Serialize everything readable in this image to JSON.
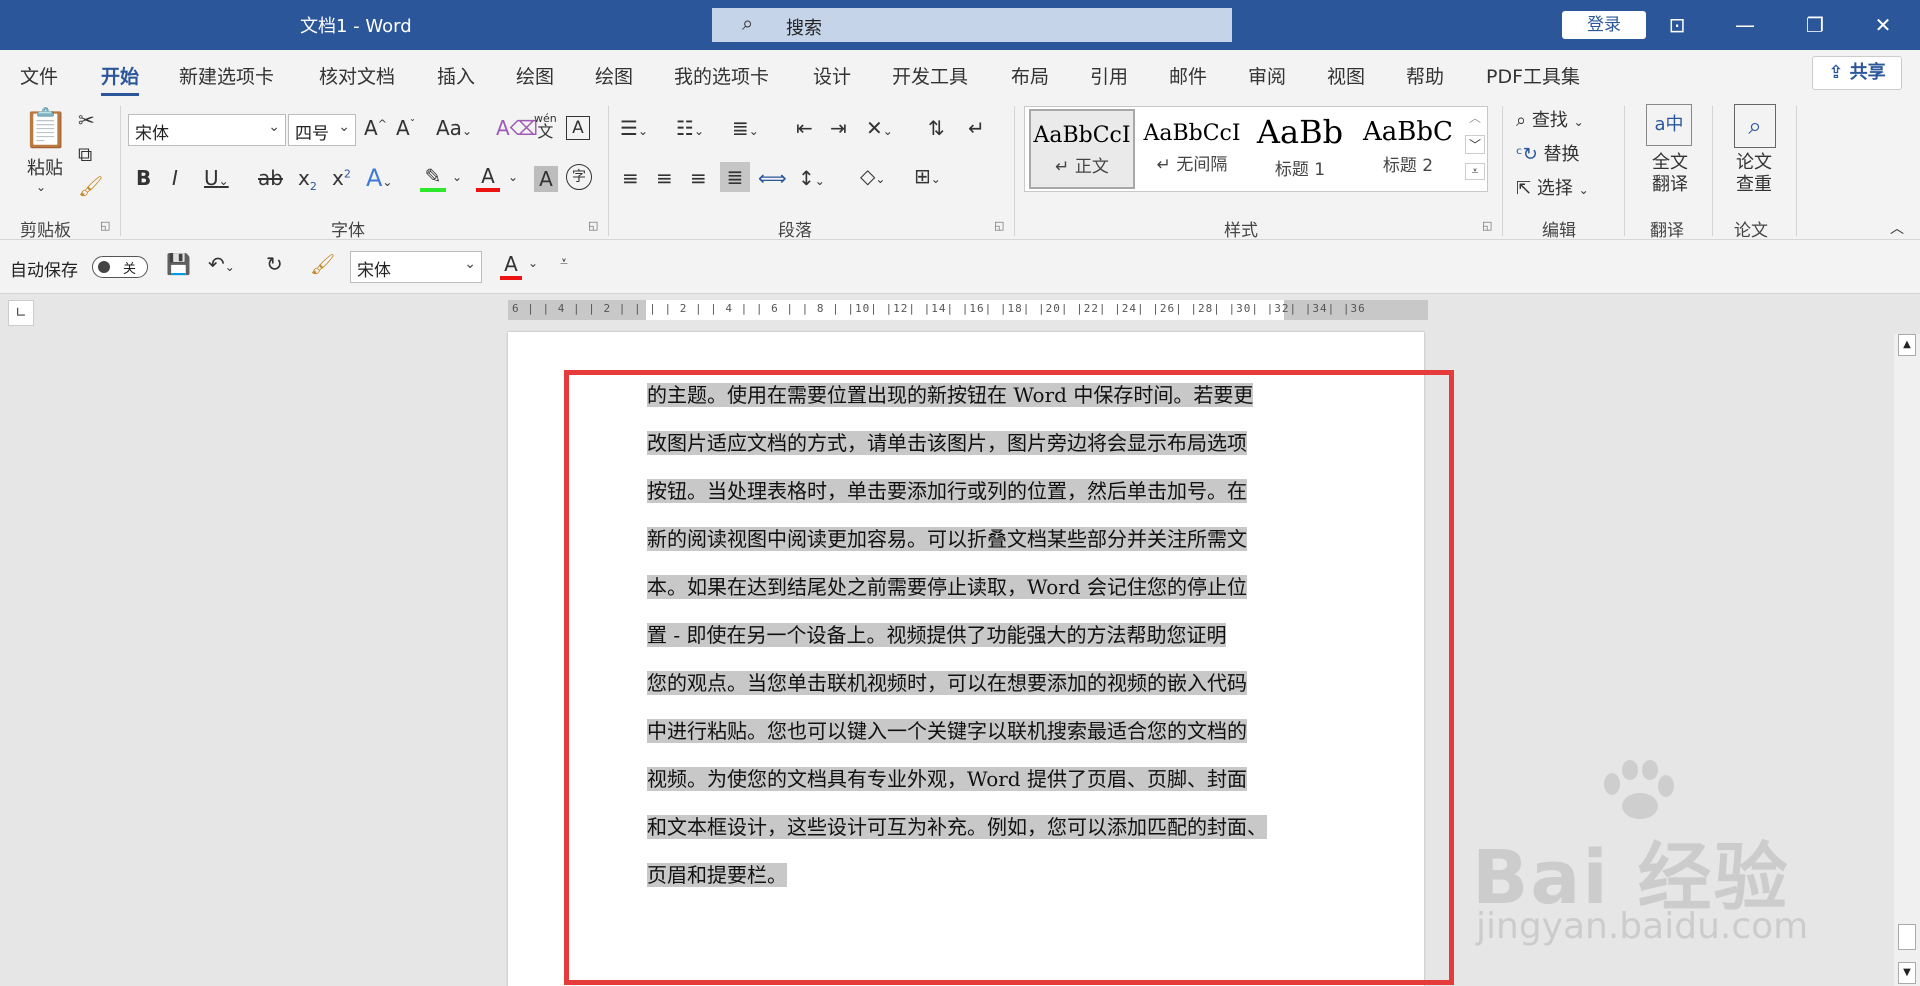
{
  "titlebar": {
    "title": "文档1  -  Word",
    "search_placeholder": "搜索",
    "login": "登录"
  },
  "tabs": [
    "文件",
    "开始",
    "新建选项卡",
    "核对文档",
    "插入",
    "绘图",
    "绘图",
    "我的选项卡",
    "设计",
    "开发工具",
    "布局",
    "引用",
    "邮件",
    "审阅",
    "视图",
    "帮助",
    "PDF工具集"
  ],
  "share": "共享",
  "ribbon": {
    "clipboard": {
      "paste": "粘贴",
      "label": "剪贴板"
    },
    "font": {
      "name": "宋体",
      "size": "四号",
      "label": "字体",
      "case": "Aa",
      "phonetic_top": "wén",
      "phonetic_bottom": "文"
    },
    "paragraph": {
      "label": "段落"
    },
    "styles": {
      "label": "样式",
      "items": [
        {
          "sample": "AaBbCcI",
          "name": "↵ 正文"
        },
        {
          "sample": "AaBbCcI",
          "name": "↵ 无间隔"
        },
        {
          "sample": "AaBb",
          "name": "标题 1"
        },
        {
          "sample": "AaBbC",
          "name": "标题 2"
        }
      ]
    },
    "editing": {
      "find": "查找",
      "replace": "替换",
      "select": "选择",
      "label": "编辑"
    },
    "translate": {
      "full": "全文",
      "translate": "翻译",
      "label": "翻译"
    },
    "paper": {
      "check1": "论文",
      "check2": "查重",
      "label": "论文"
    }
  },
  "qat": {
    "autosave": "自动保存",
    "toggle": "关",
    "font": "宋体"
  },
  "ruler": {
    "marks": "6 |  | 4 |  | 2 |  |  |  | 2 |  | 4 |  | 6 |  | 8 |  |10|  |12|  |14|  |16|  |18|  |20|  |22|  |24|  |26|  |28|  |30|  |32|  |34|  |36"
  },
  "document": {
    "lines": [
      "的主题。使用在需要位置出现的新按钮在 Word 中保存时间。若要更",
      "改图片适应文档的方式，请单击该图片，图片旁边将会显示布局选项",
      "按钮。当处理表格时，单击要添加行或列的位置，然后单击加号。在",
      "新的阅读视图中阅读更加容易。可以折叠文档某些部分并关注所需文",
      "本。如果在达到结尾处之前需要停止读取，Word 会记住您的停止位",
      "置 - 即使在另一个设备上。视频提供了功能强大的方法帮助您证明",
      "您的观点。当您单击联机视频时，可以在想要添加的视频的嵌入代码",
      "中进行粘贴。您也可以键入一个关键字以联机搜索最适合您的文档的",
      "视频。为使您的文档具有专业外观，Word 提供了页眉、页脚、封面",
      "和文本框设计，这些设计可互为补充。例如，您可以添加匹配的封面、",
      "页眉和提要栏。"
    ]
  },
  "watermark": {
    "brand": "Bai 经验",
    "url": "jingyan.baidu.com"
  },
  "colors": {
    "accent": "#2b579a",
    "highlight_box": "#e63b3b",
    "selection": "#c8c8c8"
  }
}
